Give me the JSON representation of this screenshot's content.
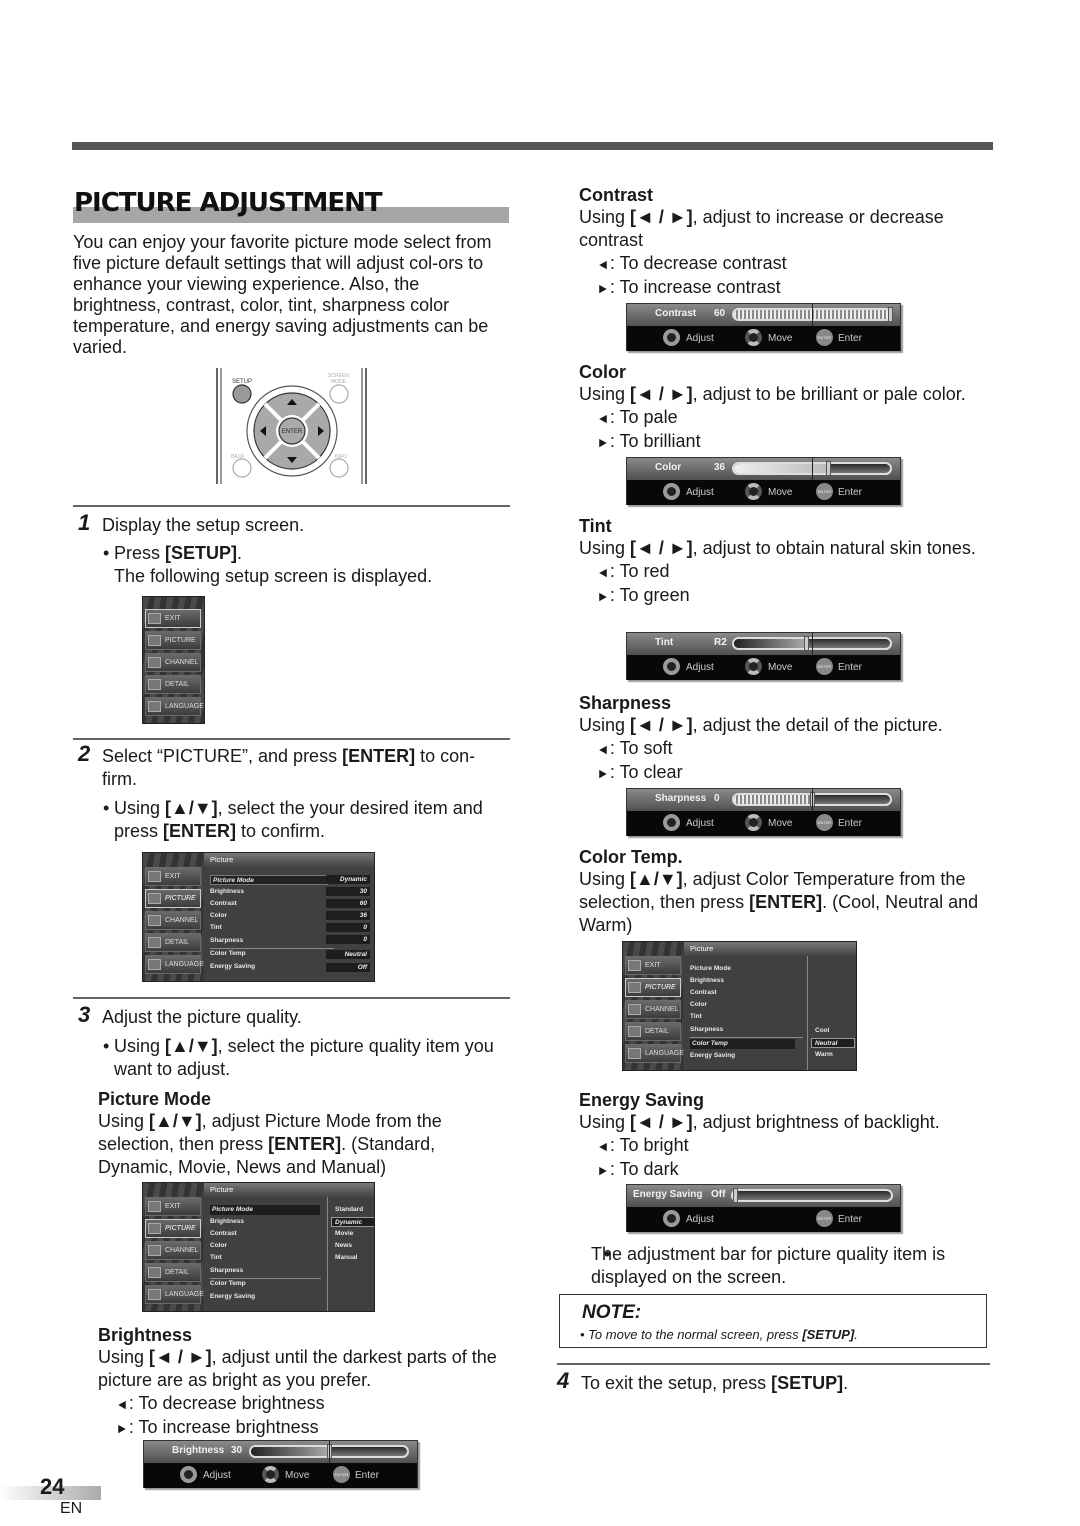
{
  "page": {
    "title": "PICTURE ADJUSTMENT",
    "intro": "You can enjoy your favorite picture mode select from five picture default settings that will adjust col-ors to enhance your viewing experience. Also, the brightness, contrast, color, tint, sharpness color temperature, and energy saving adjustments can be varied.",
    "page_number": "24",
    "language": "EN"
  },
  "remote": {
    "setup_label": "SETUP",
    "screen_mode_label": "SCREEN MODE",
    "enter_label": "ENTER",
    "back_label": "BACK",
    "info_label": "INFO"
  },
  "steps": [
    {
      "num": "1",
      "text": "Display the setup screen.",
      "bullet_pre": "Press ",
      "bullet_key": "[SETUP]",
      "bullet_post": ".",
      "sub": "The following setup screen is displayed."
    },
    {
      "num": "2",
      "text_pre": "Select “PICTURE”, and press ",
      "text_key": "[ENTER]",
      "text_post": " to con-firm.",
      "bullet_pre": "Using ",
      "bullet_key": "[▲/▼]",
      "bullet_mid": ", select the your desired item and press ",
      "bullet_key2": "[ENTER]",
      "bullet_post": " to confirm."
    },
    {
      "num": "3",
      "text": "Adjust the picture quality.",
      "bullet_pre": "Using ",
      "bullet_key": "[▲/▼]",
      "bullet_post": ", select the picture quality item you want to adjust."
    },
    {
      "num": "4",
      "text_pre": "To exit the setup, press ",
      "text_key": "[SETUP]",
      "text_post": "."
    }
  ],
  "osd_side_menu": [
    "EXIT",
    "PICTURE",
    "CHANNEL",
    "DETAIL",
    "LANGUAGE"
  ],
  "osd_picture_menu": {
    "header": "Picture",
    "items": [
      {
        "label": "Picture Mode",
        "value": "Dynamic"
      },
      {
        "label": "Brightness",
        "value": "30"
      },
      {
        "label": "Contrast",
        "value": "60"
      },
      {
        "label": "Color",
        "value": "36"
      },
      {
        "label": "Tint",
        "value": "0"
      },
      {
        "label": "Sharpness",
        "value": "0"
      },
      {
        "label": "Color Temp",
        "value": "Neutral"
      },
      {
        "label": "Energy Saving",
        "value": "Off"
      }
    ]
  },
  "picture_mode_options": [
    "Standard",
    "Dynamic",
    "Movie",
    "News",
    "Manual"
  ],
  "picture_mode_selected": "Dynamic",
  "color_temp_options": [
    "Cool",
    "Neutral",
    "Warm"
  ],
  "color_temp_selected": "Neutral",
  "sections": {
    "picture_mode": {
      "title": "Picture Mode",
      "pre": "Using ",
      "key": "[▲/▼]",
      "mid": ", adjust Picture Mode from the selection, then press ",
      "key2": "[ENTER]",
      "post": ". (Standard, Dynamic, Movie, News and Manual)"
    },
    "brightness": {
      "title": "Brightness",
      "pre": "Using ",
      "key": "[◄ / ►]",
      "post": ", adjust until the darkest parts of the picture are as bright as you prefer.",
      "left": ": To decrease brightness",
      "right": ": To increase brightness",
      "bar_label": "Brightness",
      "bar_value": "30",
      "level_percent": 50
    },
    "contrast": {
      "title": "Contrast",
      "pre": "Using ",
      "key": "[◄ / ►]",
      "post": ", adjust to increase or decrease contrast",
      "left": ": To decrease contrast",
      "right": ": To increase contrast",
      "bar_label": "Contrast",
      "bar_value": "60",
      "level_percent": 100
    },
    "color": {
      "title": "Color",
      "pre": "Using ",
      "key": "[◄ / ►]",
      "post": ", adjust to be brilliant or pale color.",
      "left": ": To pale",
      "right": ": To brilliant",
      "bar_label": "Color",
      "bar_value": "36",
      "level_percent": 60
    },
    "tint": {
      "title": "Tint",
      "pre": "Using ",
      "key": "[◄ / ►]",
      "post": ", adjust to obtain natural skin tones.",
      "left": ": To red",
      "right": ": To green",
      "bar_label": "Tint",
      "bar_value": "R2",
      "level_percent": 46
    },
    "sharpness": {
      "title": "Sharpness",
      "pre": "Using ",
      "key": "[◄ / ►]",
      "post": ", adjust the detail of the picture.",
      "left": ": To soft",
      "right": ": To clear",
      "bar_label": "Sharpness",
      "bar_value": "0",
      "level_percent": 50
    },
    "color_temp": {
      "title": "Color Temp.",
      "pre": "Using ",
      "key": "[▲/▼]",
      "mid": ", adjust Color Temperature from the selection, then press ",
      "key2": "[ENTER]",
      "post": ". (Cool, Neutral and Warm)"
    },
    "energy_saving": {
      "title": "Energy Saving",
      "pre": "Using ",
      "key": "[◄ / ►]",
      "post": ", adjust brightness of backlight.",
      "left": ": To bright",
      "right": ": To dark",
      "bar_label": "Energy Saving",
      "bar_value": "Off",
      "level_percent": 0
    }
  },
  "bar_hints": {
    "adjust": "Adjust",
    "move": "Move",
    "enter": "Enter",
    "enter_icon": "ENTER"
  },
  "arrows": {
    "left": "◄",
    "right": "►"
  },
  "after_note": "The adjustment bar for picture quality item is displayed on the screen.",
  "note": {
    "title": "NOTE:",
    "pre": "• To move to the normal screen, press ",
    "key": "[SETUP]",
    "post": "."
  }
}
